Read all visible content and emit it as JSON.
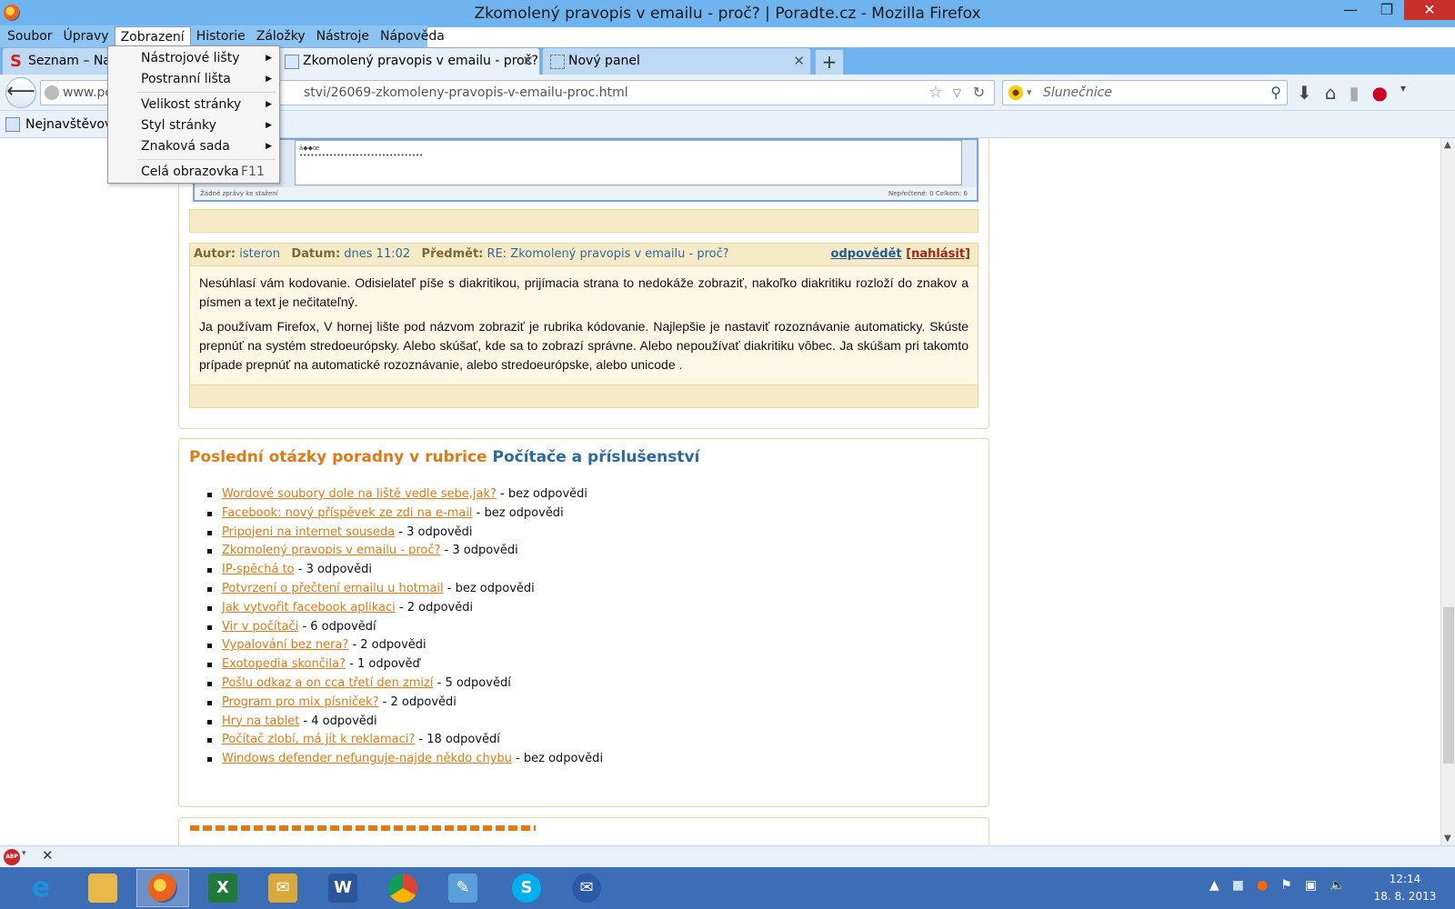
{
  "window": {
    "title": "Zkomolený pravopis v emailu - proč? | Poradte.cz - Mozilla Firefox",
    "minimize": "—",
    "maximize": "❐",
    "close": "✕"
  },
  "menubar": [
    "Soubor",
    "Úpravy",
    "Zobrazení",
    "Historie",
    "Záložky",
    "Nástroje",
    "Nápověda"
  ],
  "tabs": [
    {
      "label": "Seznam – Najd",
      "close": ""
    },
    {
      "label": "Zkomolený pravopis v emailu - proč?...",
      "close": "✕"
    },
    {
      "label": "Nový panel",
      "close": "✕"
    }
  ],
  "newtab": "+",
  "nav": {
    "url_start": "www.po",
    "url_end": "stvi/26069-zkomoleny-pravopis-v-emailu-proc.html",
    "search_placeholder": "Slunečnice"
  },
  "bookmarks": {
    "label": "Nejnavštěvova"
  },
  "view_menu": {
    "items": [
      {
        "label": "Nástrojové lišty",
        "submenu": true
      },
      {
        "label": "Postranní lišta",
        "submenu": true
      },
      {
        "label": "Velikost stránky",
        "submenu": true
      },
      {
        "label": "Styl stránky",
        "submenu": true
      },
      {
        "label": "Znaková sada",
        "submenu": true
      },
      {
        "label": "Celá obrazovka",
        "shortcut": "F11"
      }
    ]
  },
  "embed": {
    "line1": "ä◆◆œ",
    "line2": "•••••••••••••••••••••••••••••••••",
    "status_left": "Žádné zprávy ke stažení",
    "status_right": "Nepřečtené: 0    Celkem: 6"
  },
  "post": {
    "author_label": "Autor:",
    "author": "isteron",
    "date_label": "Datum:",
    "date": "dnes 11:02",
    "subject_label": "Předmět:",
    "subject": "RE: Zkomolený pravopis v emailu - proč?",
    "reply": "odpovědět",
    "report": "[nahlásit]",
    "p1": "Nesúhlasí vám kodovanie. Odisielateľ píše s diakritikou, prijímacia strana to nedokáže zobraziť, nakoľko diakritiku rozloží do znakov a písmen a text je nečitateľný.",
    "p2": "Ja používam Firefox, V hornej lište pod názvom zobraziť je rubrika kódovanie. Najlepšie je nastaviť rozoznávanie automaticky. Skúste prepnúť na systém stredoeurópsky. Alebo skúšať, kde sa to zobrazí správne. Alebo nepoužívať diakritiku vôbec. Ja skúšam pri takomto prípade prepnúť na automatické rozoznávanie, alebo stredoeurópske, alebo unicode ."
  },
  "questions": {
    "title": "Poslední otázky poradny v rubrice",
    "category": "Počítače a příslušenství",
    "items": [
      {
        "link": "Wordové soubory dole na liště vedle sebe,jak?",
        "count": " - bez odpovědi"
      },
      {
        "link": "Facebook: nový příspěvek ze zdi na e-mail",
        "count": " - bez odpovědi"
      },
      {
        "link": "Pripojeni na internet souseda",
        "count": " - 3 odpovědi"
      },
      {
        "link": "Zkomolený pravopis v emailu - proč?",
        "count": " - 3 odpovědi"
      },
      {
        "link": "IP-spěchá to",
        "count": " - 3 odpovědi"
      },
      {
        "link": "Potvrzení o přečtení emailu u hotmail",
        "count": " - bez odpovědi"
      },
      {
        "link": "Jak vytvořit facebook aplikaci",
        "count": " - 2 odpovědi"
      },
      {
        "link": "Vir v počítači",
        "count": " - 6 odpovědí"
      },
      {
        "link": "Vypalování bez nera?",
        "count": " - 2 odpovědi"
      },
      {
        "link": "Exotopedia skončila?",
        "count": " - 1 odpověď"
      },
      {
        "link": "Pošlu odkaz a on cca třetí den zmizí",
        "count": " - 5 odpovědí"
      },
      {
        "link": "Program pro mix písniček?",
        "count": " - 2 odpovědi"
      },
      {
        "link": "Hry na tablet",
        "count": " - 4 odpovědi"
      },
      {
        "link": "Počítač zlobí, má jít k reklamaci?",
        "count": " - 18 odpovědí"
      },
      {
        "link": "Windows defender nefunguje-najde někdo chybu",
        "count": " - bez odpovědi"
      }
    ]
  },
  "addonbar": {
    "abp": "ABP",
    "close": "✕"
  },
  "taskbar": {
    "apps": [
      {
        "name": "internet-explorer",
        "glyph": "e",
        "color": "#1e90e0"
      },
      {
        "name": "file-explorer",
        "glyph": "▤",
        "color": "#e8b84a"
      },
      {
        "name": "firefox",
        "glyph": "●",
        "color": "#e8631b"
      },
      {
        "name": "excel",
        "glyph": "X",
        "color": "#1f7a3a"
      },
      {
        "name": "outlook-mail",
        "glyph": "✉",
        "color": "#d9a93c"
      },
      {
        "name": "word",
        "glyph": "W",
        "color": "#2b579a"
      },
      {
        "name": "chrome",
        "glyph": "◉",
        "color": "#db4437"
      },
      {
        "name": "paint",
        "glyph": "✎",
        "color": "#5aa0d8"
      },
      {
        "name": "skype",
        "glyph": "S",
        "color": "#00aff0"
      },
      {
        "name": "thunderbird",
        "glyph": "✉",
        "color": "#2a5aa8"
      }
    ],
    "time": "12:14",
    "date": "18. 8. 2013"
  }
}
